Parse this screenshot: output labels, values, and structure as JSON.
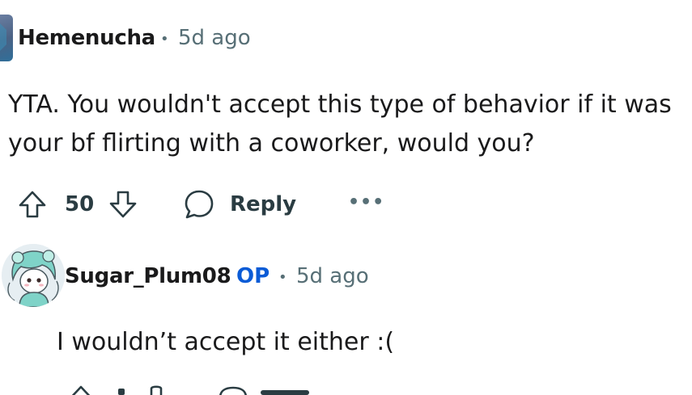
{
  "comment1": {
    "username": "Hemenucha",
    "time": "5d ago",
    "body_line1": "YTA. You wouldn't accept this type of behavior if it was",
    "body_line2": "your bf flirting with a coworker, would you?",
    "vote_count": "50",
    "reply_label": "Reply",
    "more_label": "•••"
  },
  "comment2": {
    "username": "Sugar_Plum08",
    "op_badge": "OP",
    "time": "5d ago",
    "body": "I wouldn’t accept it either :("
  },
  "separator": "•",
  "colors": {
    "meta": "#576f76",
    "op": "#0a5bd6",
    "text": "#1a1a1b"
  }
}
